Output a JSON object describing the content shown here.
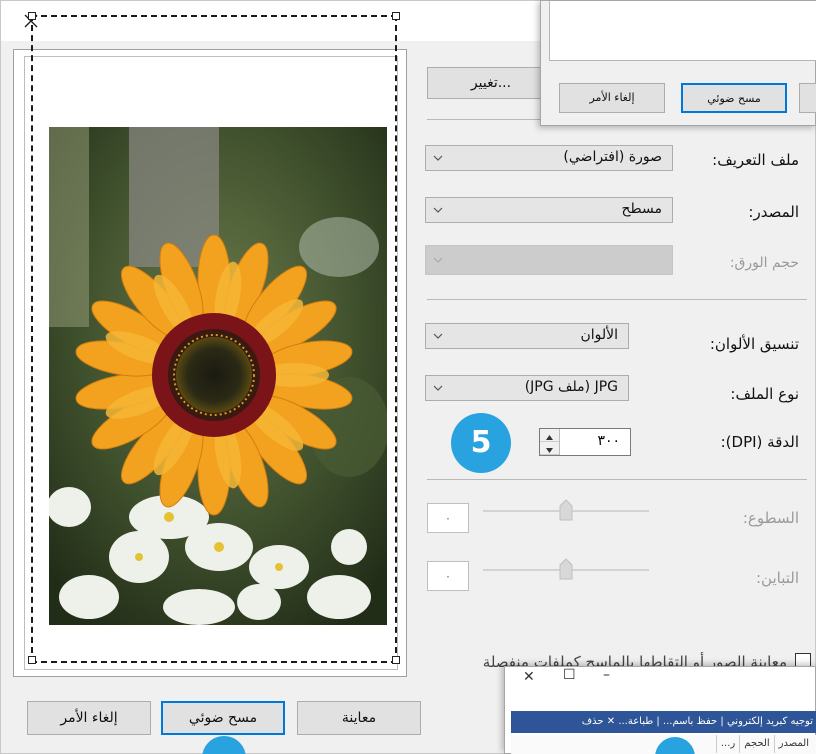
{
  "dialog": {
    "preview_button": "معاينة",
    "scan_button": "مسح ضوئي",
    "cancel_button": "إلغاء الأمر",
    "change_button": "تغيير..."
  },
  "fields": {
    "profile": {
      "label": "ملف التعريف:",
      "value": "صورة (افتراضي)"
    },
    "source": {
      "label": "المصدر:",
      "value": "مسطح"
    },
    "paper_size": {
      "label": "حجم الورق:",
      "value": ""
    },
    "color_format": {
      "label": "تنسيق الألوان:",
      "value": "الألوان"
    },
    "file_type": {
      "label": "نوع الملف:",
      "value": "JPG (ملف JPG)"
    },
    "resolution": {
      "label": "الدقة (DPI):",
      "value": "٣٠٠"
    },
    "brightness": {
      "label": "السطوع:",
      "value": "٠"
    },
    "contrast": {
      "label": "التباين:",
      "value": "٠"
    },
    "separate_files": {
      "label": "معاينة الصور أو التقاطها بالماسح كملفات منفصلة"
    }
  },
  "step_badge": "5",
  "overlay_top": {
    "cancel_label": "إلغاء الأمر",
    "scan_label": "مسح ضوئي"
  },
  "overlay_bottom": {
    "close_glyph": "✕",
    "maximize_glyph": "☐",
    "minimize_glyph": "–",
    "ribbon": "توجيه كبريد إلكتروني  |  حفظ باسم...  |  طباعة...  ✕ حذف",
    "columns": [
      "المصدر",
      "الحجم",
      "ر..."
    ]
  },
  "colors": {
    "accent": "#0078d7",
    "badge": "#29a3e0",
    "ribbon": "#2e5597"
  }
}
